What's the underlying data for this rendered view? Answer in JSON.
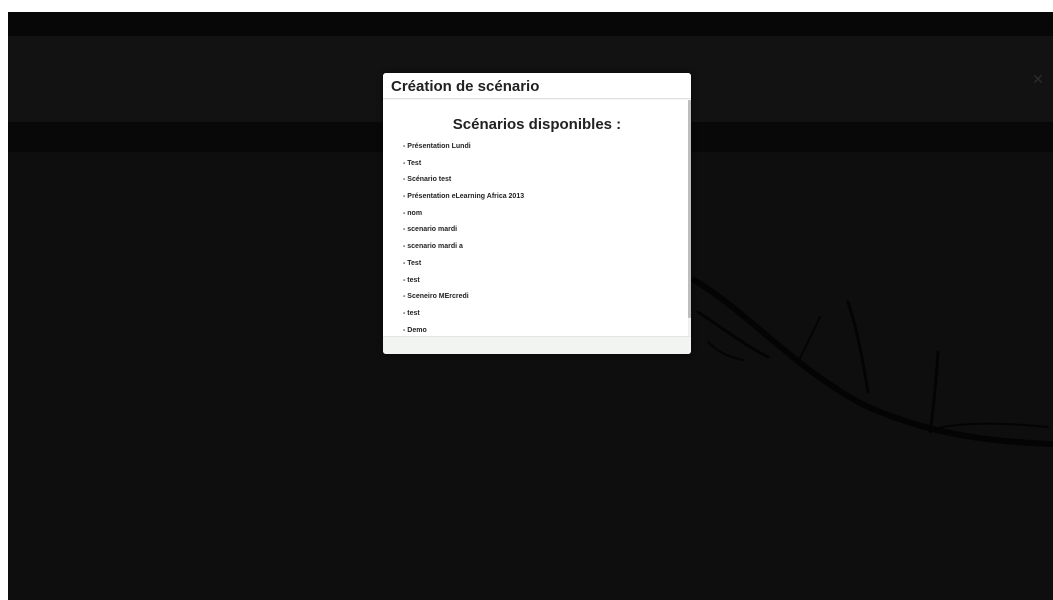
{
  "modal": {
    "title": "Création de scénario",
    "section_title": "Scénarios disponibles :",
    "scenarios": [
      "- Présentation Lundi",
      "- Test",
      "- Scénario test",
      "- Présentation eLearning Africa 2013",
      "- nom",
      "- scenario mardi",
      "- scenario mardi a",
      "- Test",
      "- test",
      "- Sceneiro MErcredi",
      "- test",
      "- Demo"
    ]
  },
  "background": {
    "corner_icon": "close-icon"
  },
  "colors": {
    "backdrop": "#0e0e0e",
    "modal_body": "#ffffff",
    "modal_footer": "#f1f4f1",
    "text": "#222222"
  }
}
